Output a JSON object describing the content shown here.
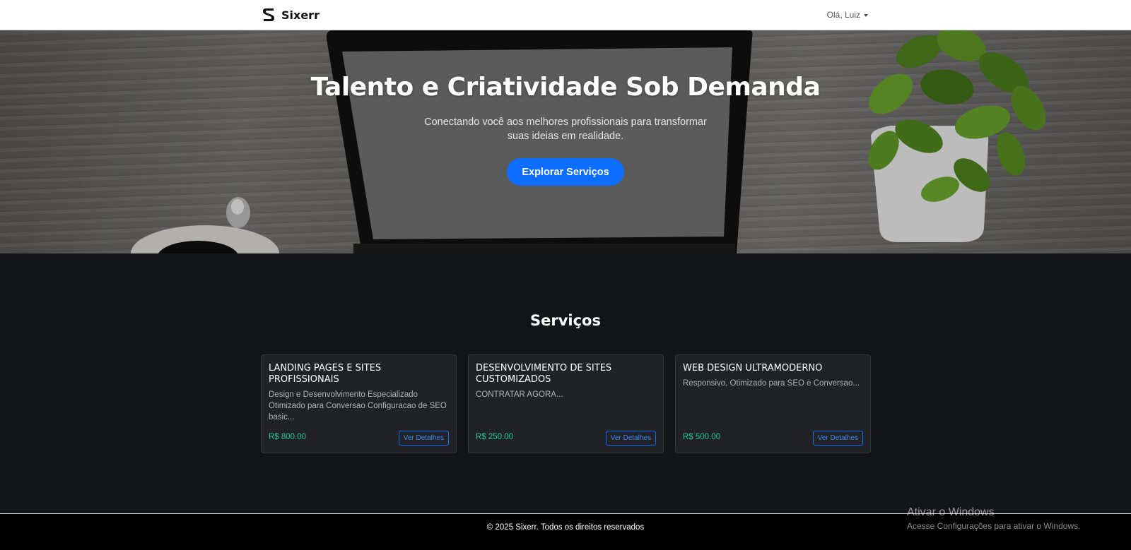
{
  "navbar": {
    "brand_name": "Sixerr",
    "logo_icon": "sixerr-s-logo-icon",
    "user_greeting": "Olá, Luiz"
  },
  "hero": {
    "title": "Talento e Criatividade Sob Demanda",
    "subtitle": "Conectando você aos melhores profissionais para transformar suas ideias em realidade.",
    "cta_label": "Explorar Serviços"
  },
  "services": {
    "heading": "Serviços",
    "cards": [
      {
        "title": "LANDING PAGES E SITES PROFISSIONAIS",
        "description": "Design e Desenvolvimento Especializado Otimizado para Conversao Configuracao de SEO basic...",
        "price": "R$ 800.00",
        "button_label": "Ver Detalhes"
      },
      {
        "title": "DESENVOLVIMENTO DE SITES CUSTOMIZADOS",
        "description": "CONTRATAR AGORA...",
        "price": "R$ 250.00",
        "button_label": "Ver Detalhes"
      },
      {
        "title": "WEB DESIGN ULTRAMODERNO",
        "description": "Responsivo, Otimizado para SEO e Conversao...",
        "price": "R$ 500.00",
        "button_label": "Ver Detalhes"
      }
    ]
  },
  "footer": {
    "copyright": "© 2025 Sixerr. Todos os direitos reservados"
  },
  "os_watermark": {
    "title": "Ativar o Windows",
    "subtitle": "Acesse Configurações para ativar o Windows."
  },
  "colors": {
    "primary": "#0d6efd",
    "price": "#20c997",
    "page_bg": "#141519",
    "card_bg": "#212226",
    "footer_bg": "#000000"
  }
}
